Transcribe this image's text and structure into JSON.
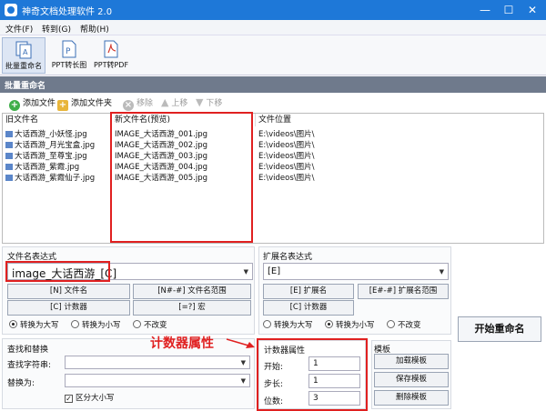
{
  "window": {
    "title": "神奇文档处理软件 2.0",
    "minimize": "—",
    "maximize": "☐",
    "close": "✕"
  },
  "menu": {
    "file": "文件(F)",
    "goto": "转到(G)",
    "help": "帮助(H)"
  },
  "toolbar": {
    "batch_rename": "批量重命名",
    "ppt_to_image": "PPT转长图",
    "ppt_to_pdf": "PPT转PDF"
  },
  "section_title": "批量重命名",
  "list_tools": {
    "add_file": "添加文件",
    "add_folder": "添加文件夹",
    "remove": "移除",
    "move_up": "上移",
    "move_down": "下移"
  },
  "table": {
    "headers": {
      "old_name": "旧文件名",
      "new_name": "新文件名(预览)",
      "location": "文件位置"
    },
    "rows": [
      {
        "old": "大话西游_小妖怪.jpg",
        "new": "IMAGE_大话西游_001.jpg",
        "loc": "E:\\videos\\图片\\"
      },
      {
        "old": "大话西游_月光宝盒.jpg",
        "new": "IMAGE_大话西游_002.jpg",
        "loc": "E:\\videos\\图片\\"
      },
      {
        "old": "大话西游_至尊宝.jpg",
        "new": "IMAGE_大话西游_003.jpg",
        "loc": "E:\\videos\\图片\\"
      },
      {
        "old": "大话西游_紫霞.jpg",
        "new": "IMAGE_大话西游_004.jpg",
        "loc": "E:\\videos\\图片\\"
      },
      {
        "old": "大话西游_紫霞仙子.jpg",
        "new": "IMAGE_大话西游_005.jpg",
        "loc": "E:\\videos\\图片\\"
      }
    ]
  },
  "name_expr": {
    "title": "文件名表达式",
    "value": "image_大话西游_[C]",
    "btn_n": "[N] 文件名",
    "btn_range": "[N#-#] 文件名范围",
    "btn_c": "[C] 计数器",
    "btn_macro": "[=?] 宏",
    "radio_upper": "转换为大写",
    "radio_lower": "转换为小写",
    "radio_keep": "不改变"
  },
  "ext_expr": {
    "title": "扩展名表达式",
    "value": "[E]",
    "btn_e": "[E] 扩展名",
    "btn_range": "[E#-#] 扩展名范围",
    "btn_c": "[C] 计数器",
    "radio_upper": "转换为大写",
    "radio_lower": "转换为小写",
    "radio_keep": "不改变"
  },
  "start_button": "开始重命名",
  "find_replace": {
    "title": "查找和替换",
    "find_label": "查找字符串:",
    "replace_label": "替换为:",
    "case_label": "区分大小写"
  },
  "annotation": "计数器属性",
  "counter": {
    "title": "计数器属性",
    "start_label": "开始:",
    "start_value": "1",
    "step_label": "步长:",
    "step_value": "1",
    "digits_label": "位数:",
    "digits_value": "3"
  },
  "template": {
    "title": "模板",
    "load": "加载模板",
    "save": "保存模板",
    "delete": "删除模板"
  },
  "colors": {
    "titlebar": "#1e78d8",
    "section": "#6f7a8c",
    "highlight": "#e02020"
  }
}
